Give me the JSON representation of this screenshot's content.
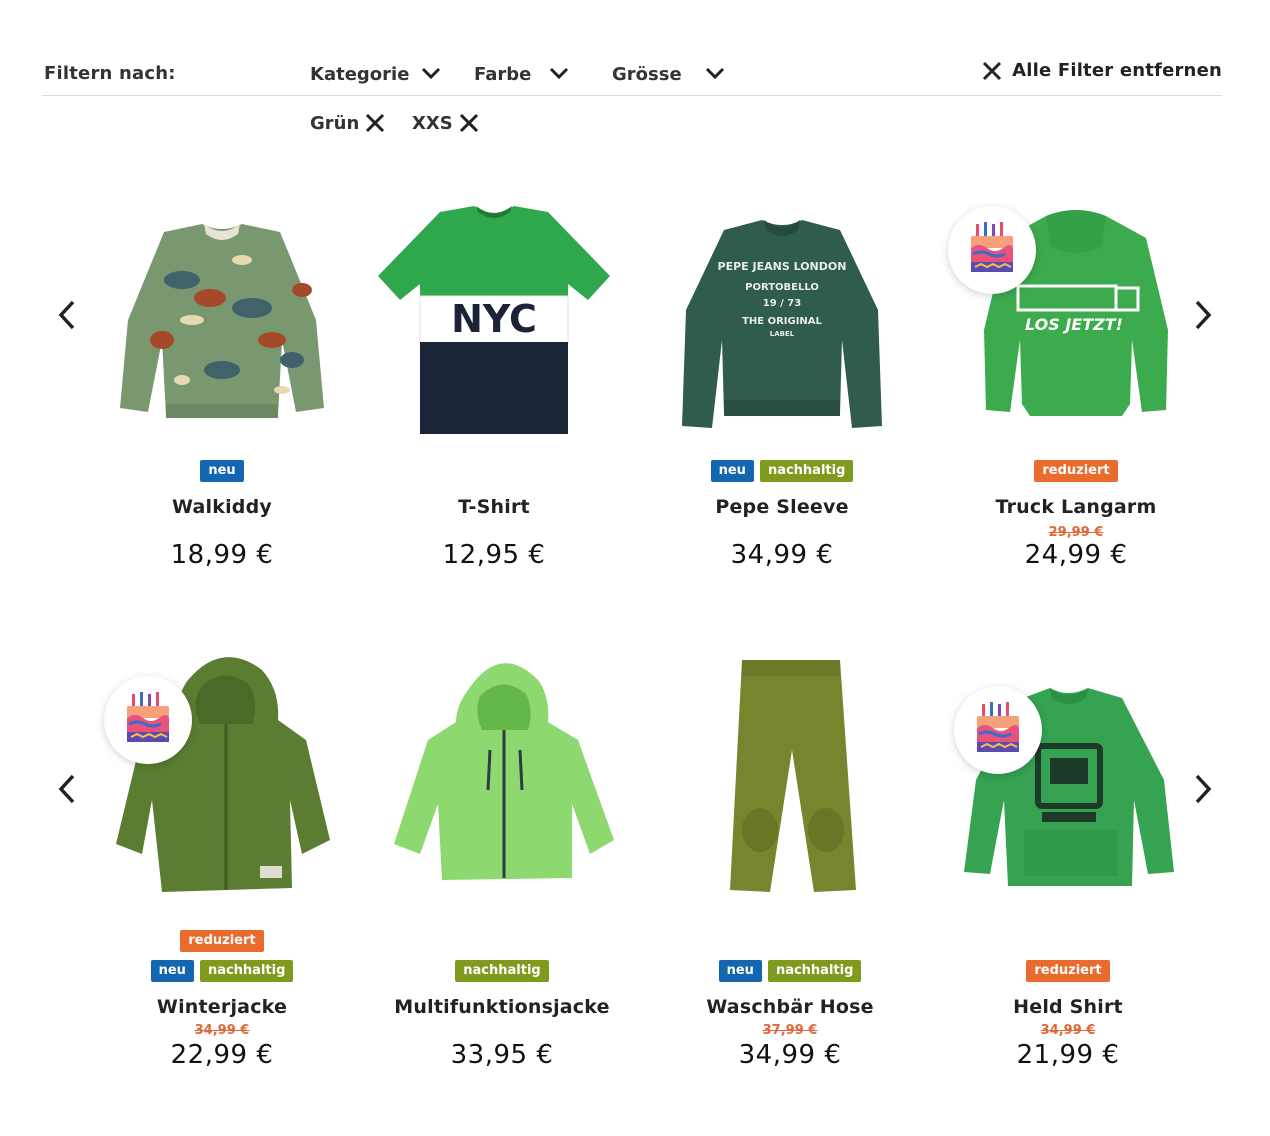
{
  "filters": {
    "label": "Filtern nach:",
    "dropdowns": [
      {
        "label": "Kategorie",
        "icon": "chevron-down-icon"
      },
      {
        "label": "Farbe",
        "icon": "chevron-down-icon"
      },
      {
        "label": "Grösse",
        "icon": "chevron-down-icon"
      }
    ],
    "clear_all_label": "Alle Filter entfernen",
    "active_chips": [
      {
        "label": "Grün"
      },
      {
        "label": "XXS"
      }
    ]
  },
  "badges": {
    "neu": "neu",
    "nachhaltig": "nachhaltig",
    "reduziert": "reduziert"
  },
  "colors": {
    "neu": "#1366b0",
    "nachhaltig": "#7f9b1d",
    "reduziert": "#ea6b2d"
  },
  "rows": [
    {
      "products": [
        {
          "name": "Walkiddy",
          "price": "18,99 €",
          "old_price": "",
          "badges": [
            "neu"
          ],
          "birthday_icon": false,
          "image": "dino-sweater-image"
        },
        {
          "name": "T-Shirt",
          "price": "12,95 €",
          "old_price": "",
          "badges": [],
          "birthday_icon": false,
          "image": "nyc-tshirt-image"
        },
        {
          "name": "Pepe Sleeve",
          "price": "34,99 €",
          "old_price": "",
          "badges": [
            "neu",
            "nachhaltig"
          ],
          "birthday_icon": false,
          "image": "pepe-sweater-image"
        },
        {
          "name": "Truck Langarm",
          "price": "24,99 €",
          "old_price": "29,99 €",
          "badges": [
            "reduziert"
          ],
          "birthday_icon": true,
          "image": "truck-sweater-image"
        }
      ]
    },
    {
      "products": [
        {
          "name": "Winterjacke",
          "price": "22,99 €",
          "old_price": "34,99 €",
          "badges": [
            "reduziert",
            "neu",
            "nachhaltig"
          ],
          "birthday_icon": true,
          "image": "fleece-jacket-image"
        },
        {
          "name": "Multifunktionsjacke",
          "price": "33,95 €",
          "old_price": "",
          "badges": [
            "nachhaltig"
          ],
          "birthday_icon": false,
          "image": "rain-jacket-image"
        },
        {
          "name": "Waschbär Hose",
          "price": "34,99 €",
          "old_price": "37,99 €",
          "badges": [
            "neu",
            "nachhaltig"
          ],
          "birthday_icon": false,
          "image": "fleece-pants-image"
        },
        {
          "name": "Held Shirt",
          "price": "21,99 €",
          "old_price": "34,99 €",
          "badges": [
            "reduziert"
          ],
          "birthday_icon": true,
          "image": "truck-shirt-image"
        }
      ]
    }
  ],
  "rows_render": {
    "r0": {
      "p0": {
        "badge0": "neu"
      },
      "p2": {
        "badge0": "neu",
        "badge1": "nachhaltig"
      },
      "p3": {
        "badge0": "reduziert"
      }
    },
    "r1": {
      "p0": {
        "badge0": "reduziert",
        "badge1": "neu",
        "badge2": "nachhaltig"
      },
      "p1": {
        "badge0": "nachhaltig"
      },
      "p2": {
        "badge0": "neu",
        "badge1": "nachhaltig"
      },
      "p3": {
        "badge0": "reduziert"
      }
    }
  }
}
